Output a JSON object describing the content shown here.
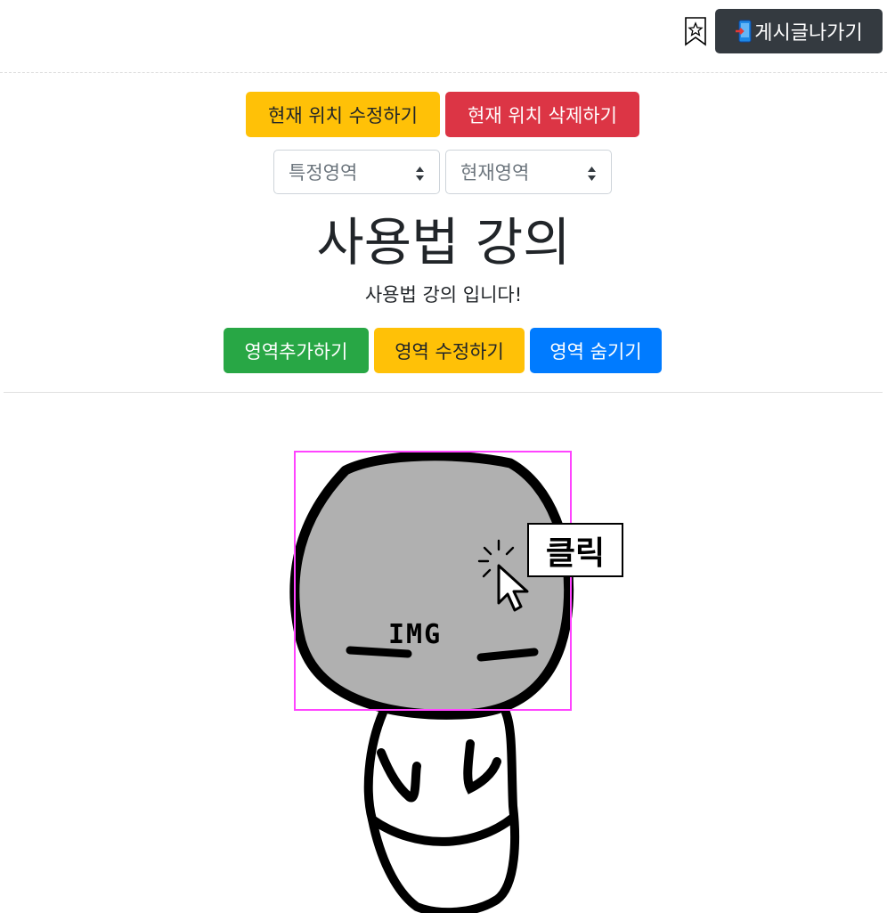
{
  "header": {
    "exit_label": "게시글나가기",
    "bookmark_icon": "bookmark-star-icon",
    "phone_icon": "mobile-exit-icon"
  },
  "toolbar": {
    "edit_location_label": "현재 위치 수정하기",
    "delete_location_label": "현재 위치 삭제하기"
  },
  "selects": {
    "specific_area": "특정영역",
    "current_area": "현재영역"
  },
  "main": {
    "title": "사용법 강의",
    "subtitle": "사용법 강의 입니다!"
  },
  "actions": {
    "add_area_label": "영역추가하기",
    "edit_area_label": "영역 수정하기",
    "hide_area_label": "영역 숨기기"
  },
  "canvas": {
    "image_text": "IMG",
    "click_label": "클릭",
    "highlight_color": "#ff44ff"
  },
  "colors": {
    "warning": "#ffc107",
    "danger": "#dc3545",
    "success": "#28a745",
    "primary": "#007bff",
    "dark": "#343a40"
  }
}
